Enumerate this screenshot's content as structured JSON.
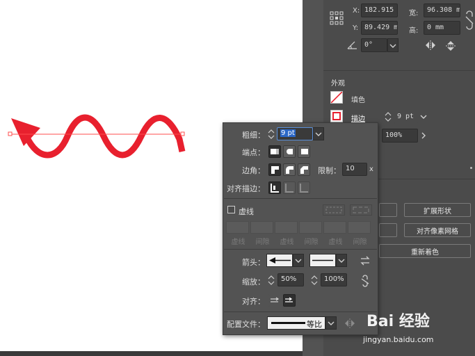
{
  "transform": {
    "x_label": "X:",
    "x_value": "182.915",
    "y_label": "Y:",
    "y_value": "89.429 m",
    "w_label": "宽:",
    "w_value": "96.308 m",
    "h_label": "高:",
    "h_value": "0 mm",
    "rotate_value": "0°"
  },
  "appearance": {
    "title": "外观",
    "fill_label": "填色",
    "stroke_label": "描边",
    "stroke_weight": "9 pt",
    "opacity": "100%"
  },
  "actions": {
    "expand_shape": "扩展形状",
    "align_pixel_grid": "对齐像素网格",
    "recolor": "重新着色"
  },
  "stroke_popup": {
    "weight_label": "粗细：",
    "weight_value": "9 pt",
    "cap_label": "端点：",
    "corner_label": "边角：",
    "limit_label": "限制：",
    "limit_value": "10",
    "limit_unit": "x",
    "align_label": "对齐描边：",
    "dashed_label": "虚线",
    "dash_labels": [
      "虚线",
      "间隙",
      "虚线",
      "间隙",
      "虚线",
      "间隙"
    ],
    "arrow_label": "箭头：",
    "scale_label": "缩放：",
    "scale_start": "50%",
    "scale_end": "100%",
    "align_arrow_label": "对齐：",
    "profile_label": "配置文件：",
    "profile_value": "等比"
  },
  "watermark": {
    "logo_text": "Bai 经验",
    "url": "jingyan.baidu.com"
  },
  "colors": {
    "stroke_red": "#e8202e",
    "panel_bg": "#535353",
    "selection_line": "#ff4d4d"
  }
}
